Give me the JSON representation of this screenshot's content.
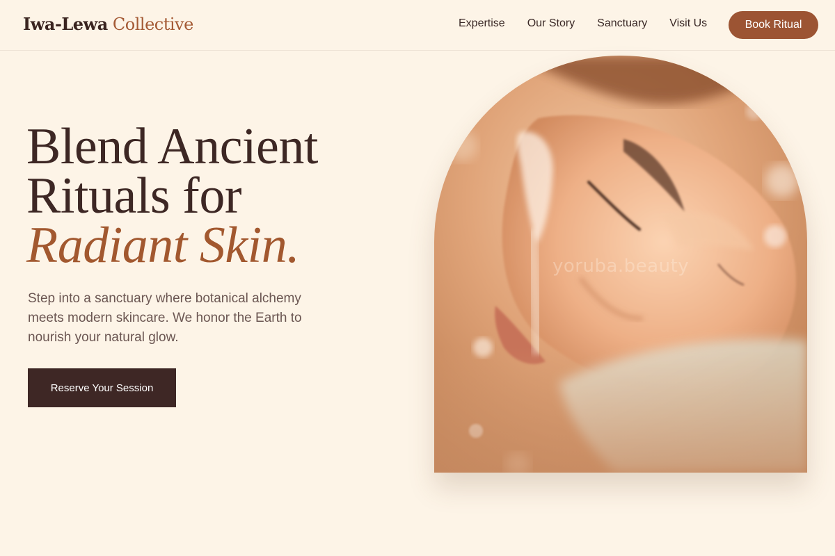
{
  "brand": {
    "name_main": "Iwa-Lewa",
    "name_accent": "Collective"
  },
  "nav": {
    "links": [
      "Expertise",
      "Our Story",
      "Sanctuary",
      "Visit Us"
    ],
    "cta_label": "Book Ritual"
  },
  "hero": {
    "title_line1": "Blend Ancient",
    "title_line2": "Rituals for",
    "title_accent": "Radiant Skin.",
    "subtitle": "Step into a sanctuary where botanical alchemy meets modern skincare. We honor the Earth to nourish your natural glow.",
    "cta_label": "Reserve Your Session"
  },
  "image": {
    "watermark": "yoruba.beauty"
  },
  "colors": {
    "background": "#fdf4e7",
    "dark": "#3e2725",
    "accent": "#9c5433"
  }
}
